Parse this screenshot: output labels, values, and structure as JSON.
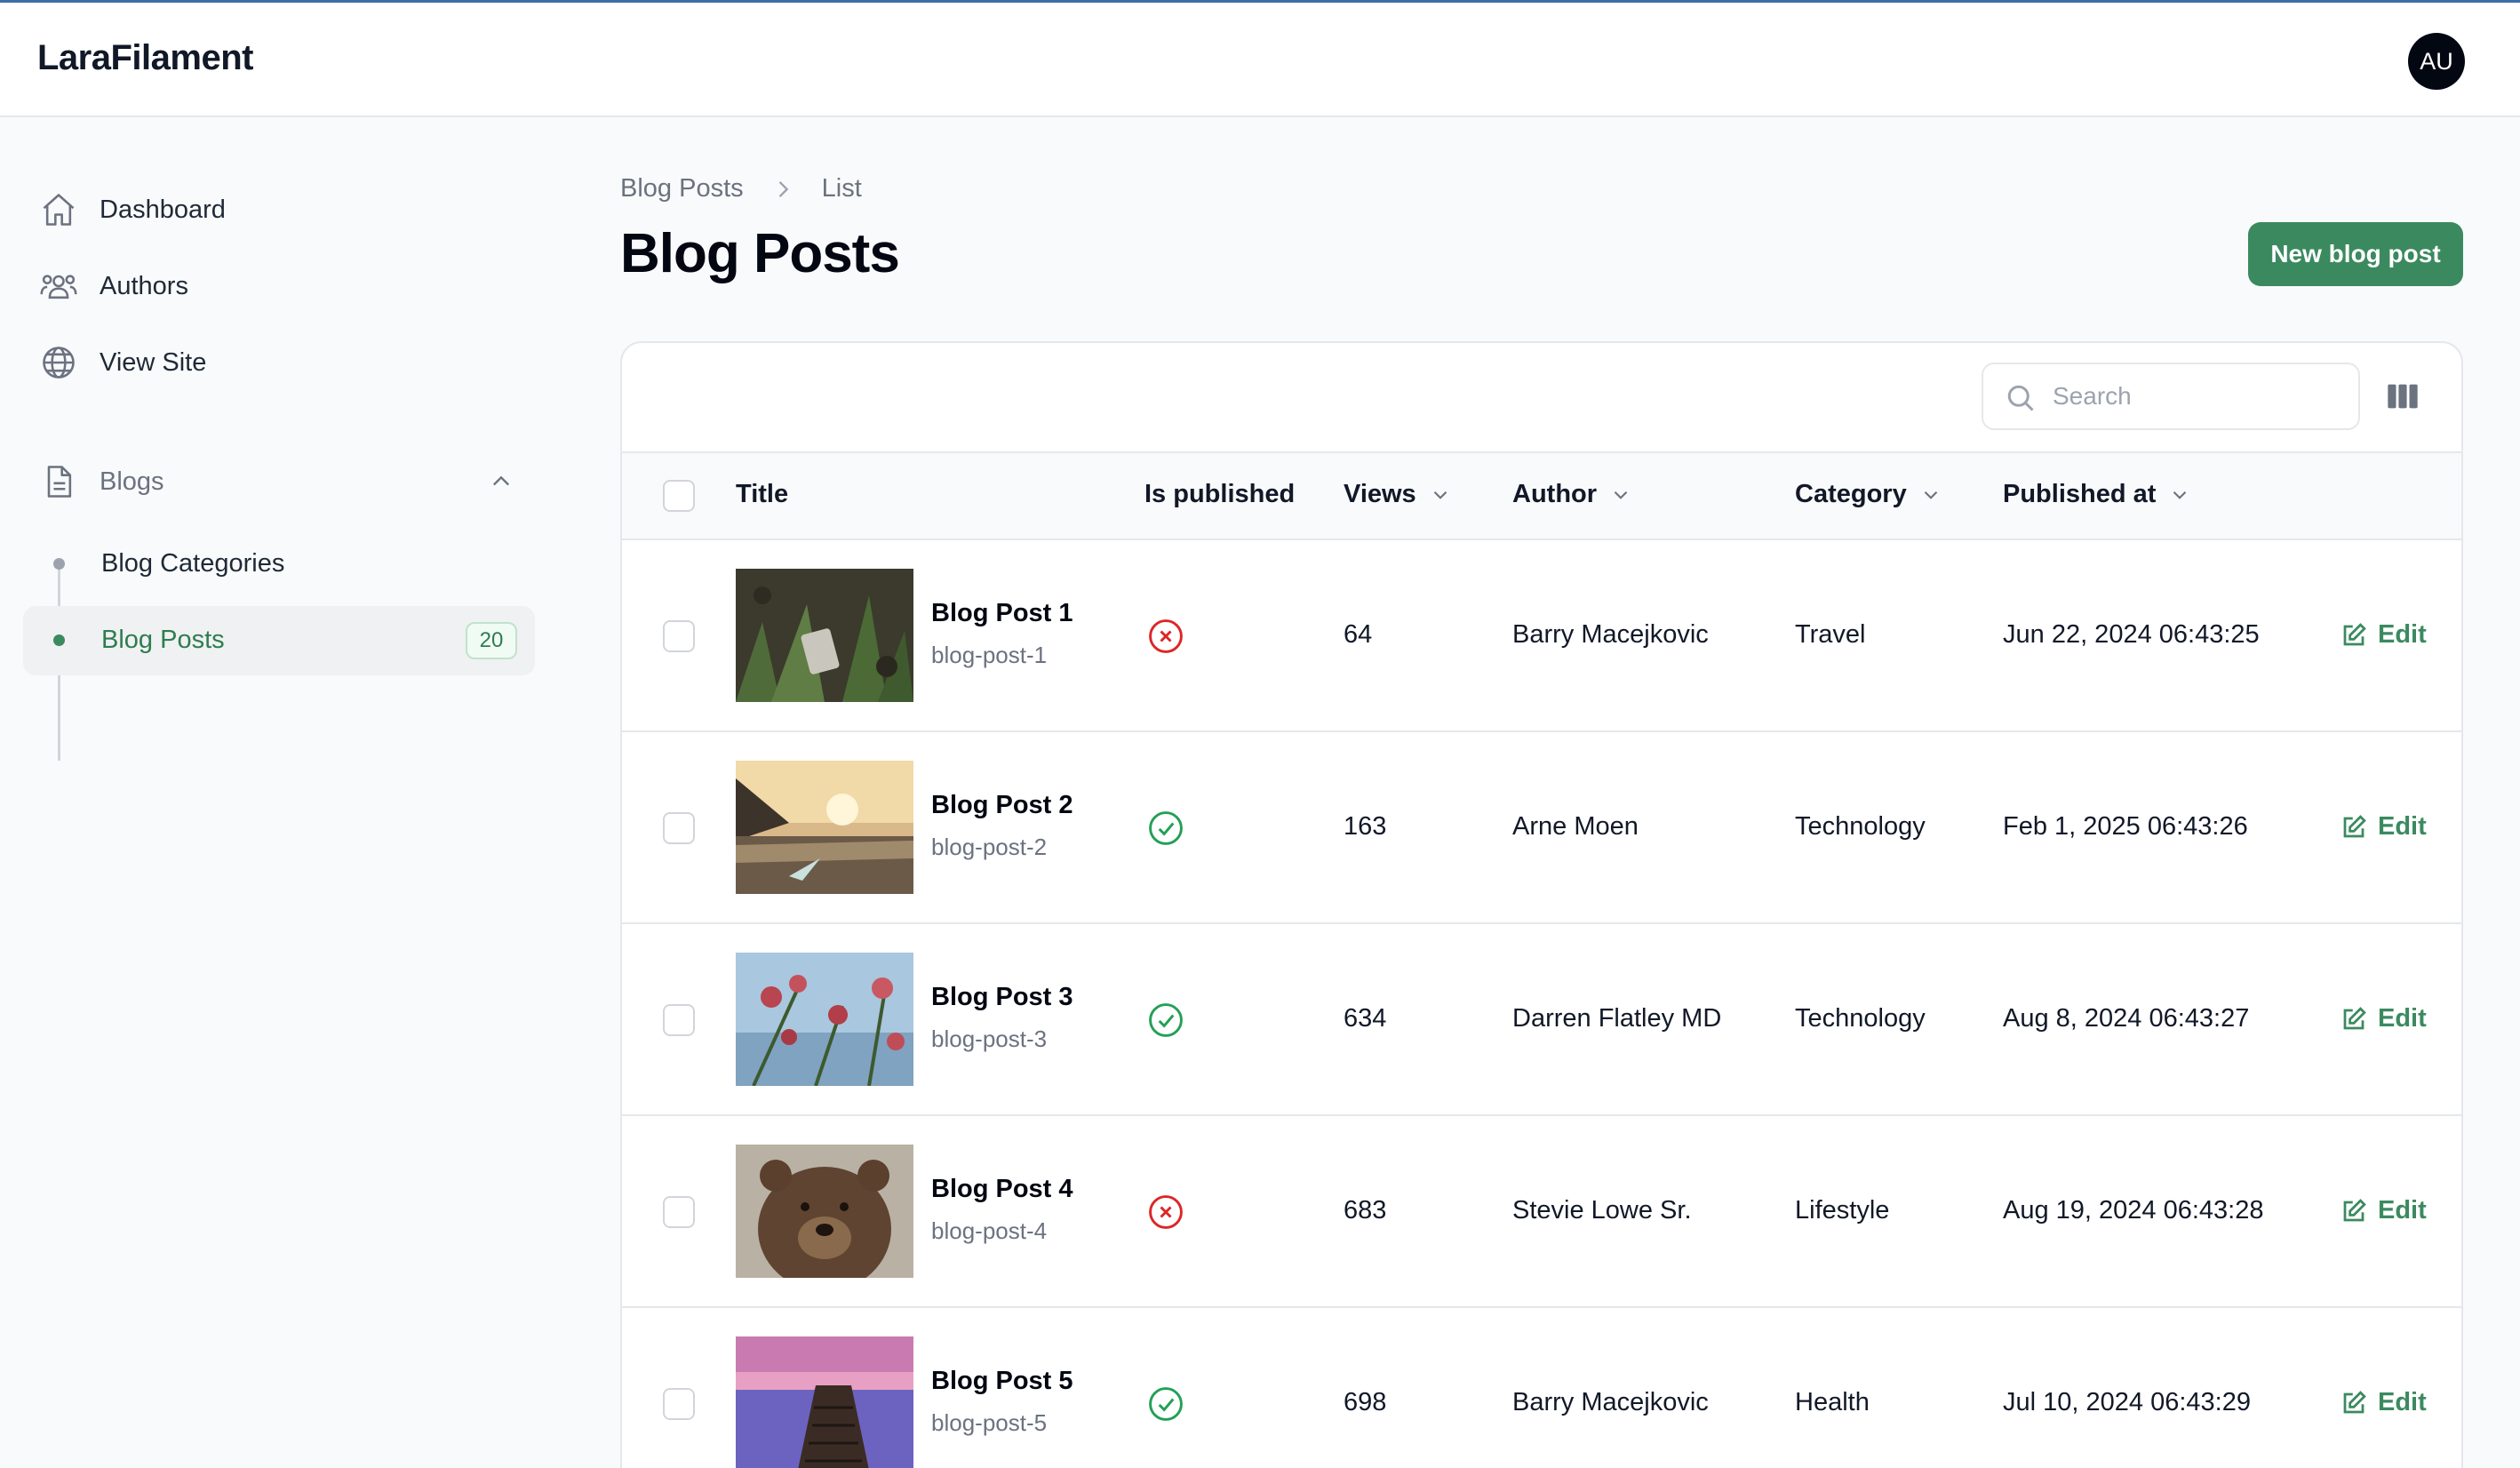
{
  "app": {
    "brand": "LaraFilament",
    "user_initials": "AU"
  },
  "sidebar": {
    "items": [
      {
        "label": "Dashboard",
        "icon": "home-icon"
      },
      {
        "label": "Authors",
        "icon": "users-icon"
      },
      {
        "label": "View Site",
        "icon": "globe-icon"
      }
    ],
    "group": {
      "label": "Blogs",
      "icon": "document-icon",
      "children": [
        {
          "label": "Blog Categories"
        },
        {
          "label": "Blog Posts",
          "badge": "20",
          "active": true
        }
      ]
    }
  },
  "breadcrumb": {
    "parent": "Blog Posts",
    "current": "List"
  },
  "page": {
    "title": "Blog Posts",
    "new_button": "New blog post"
  },
  "table": {
    "search_placeholder": "Search",
    "columns": {
      "title": "Title",
      "is_published": "Is published",
      "views": "Views",
      "author": "Author",
      "category": "Category",
      "published_at": "Published at"
    },
    "edit_label": "Edit",
    "rows": [
      {
        "title": "Blog Post 1",
        "slug": "blog-post-1",
        "published": false,
        "views": "64",
        "author": "Barry Macejkovic",
        "category": "Travel",
        "published_at": "Jun 22, 2024 06:43:25"
      },
      {
        "title": "Blog Post 2",
        "slug": "blog-post-2",
        "published": true,
        "views": "163",
        "author": "Arne Moen",
        "category": "Technology",
        "published_at": "Feb 1, 2025 06:43:26"
      },
      {
        "title": "Blog Post 3",
        "slug": "blog-post-3",
        "published": true,
        "views": "634",
        "author": "Darren Flatley MD",
        "category": "Technology",
        "published_at": "Aug 8, 2024 06:43:27"
      },
      {
        "title": "Blog Post 4",
        "slug": "blog-post-4",
        "published": false,
        "views": "683",
        "author": "Stevie Lowe Sr.",
        "category": "Lifestyle",
        "published_at": "Aug 19, 2024 06:43:28"
      },
      {
        "title": "Blog Post 5",
        "slug": "blog-post-5",
        "published": true,
        "views": "698",
        "author": "Barry Macejkovic",
        "category": "Health",
        "published_at": "Jul 10, 2024 06:43:29"
      }
    ]
  },
  "colors": {
    "primary": "#3b8a5f",
    "danger": "#dc2626",
    "success": "#22a055"
  }
}
